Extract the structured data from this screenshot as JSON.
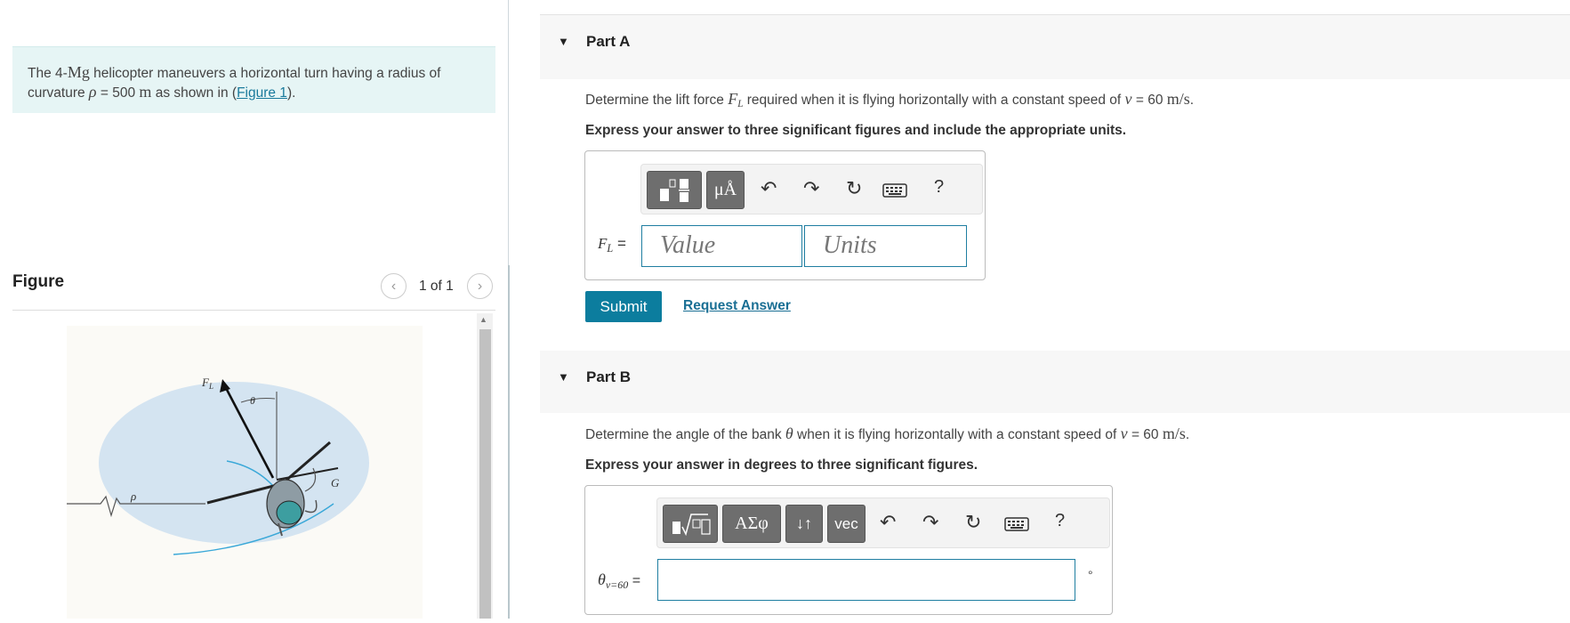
{
  "problem": {
    "intro_pre": "The 4-",
    "intro_mass": "Mg",
    "intro_mid": " helicopter maneuvers a horizontal turn having a radius of curvature ",
    "intro_rho": "ρ",
    "intro_eq": " = 500 ",
    "intro_m": "m",
    "intro_post1": " as shown in (",
    "figure_link": "Figure 1",
    "intro_post2": ")."
  },
  "figure": {
    "label": "Figure",
    "pager": "1 of 1",
    "prev_icon": "chevron-left-icon",
    "next_icon": "chevron-right-icon",
    "labels": {
      "fl": "F",
      "fl_sub": "L",
      "theta": "θ",
      "rho": "ρ",
      "g": "G"
    }
  },
  "part_a": {
    "title": "Part A",
    "q_pre": "Determine the lift force ",
    "q_sym": "F",
    "q_sub": "L",
    "q_mid": " required when it is flying horizontally with a constant speed of ",
    "q_v": "v",
    "q_val": " = 60 ",
    "q_unit": "m/s",
    "q_end": ".",
    "instruction": "Express your answer to three significant figures and include the appropriate units.",
    "toolbar": {
      "templates_icon": "templates-icon",
      "units_label": "μÅ",
      "undo_icon": "undo-icon",
      "redo_icon": "redo-icon",
      "reset_icon": "reset-icon",
      "keyboard_icon": "keyboard-icon",
      "help_label": "?"
    },
    "answer_label": "F",
    "answer_label_sub": "L",
    "answer_eq": "=",
    "value_placeholder": "Value",
    "units_placeholder": "Units",
    "submit_label": "Submit",
    "request_label": "Request Answer"
  },
  "part_b": {
    "title": "Part B",
    "q_pre": "Determine the angle of the bank ",
    "q_sym": "θ",
    "q_mid": " when it is flying horizontally with a constant speed of ",
    "q_v": "v",
    "q_val": " = 60 ",
    "q_unit": "m/s",
    "q_end": ".",
    "instruction": "Express your answer in degrees to three significant figures.",
    "toolbar": {
      "templates_icon": "templates-radical-icon",
      "greek_label": "ΑΣφ",
      "arrows_label": "↓↑",
      "vec_label": "vec",
      "undo_icon": "undo-icon",
      "redo_icon": "redo-icon",
      "reset_icon": "reset-icon",
      "keyboard_icon": "keyboard-icon",
      "help_label": "?"
    },
    "answer_label": "θ",
    "answer_label_sub": "v=60",
    "answer_eq": "=",
    "unit_suffix": "°"
  },
  "colors": {
    "accent": "#0c7d9e",
    "intro_bg": "#e6f5f5",
    "field_border": "#1f7ea1",
    "button_gray": "#6e6e6e"
  }
}
